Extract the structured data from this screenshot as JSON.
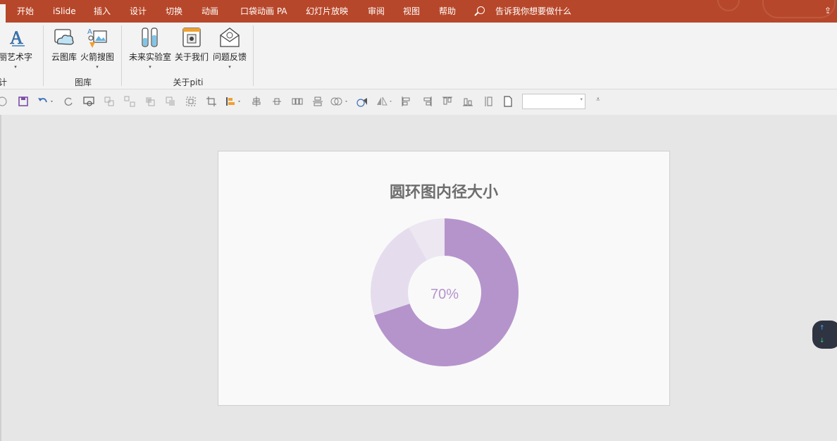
{
  "menu_tabs": [
    "开始",
    "iSlide",
    "插入",
    "设计",
    "切换",
    "动画",
    "口袋动画 PA",
    "幻灯片放映",
    "审阅",
    "视图",
    "帮助"
  ],
  "tell_me": "告诉我你想要做什么",
  "ribbon": {
    "partial_button": "丽艺术字",
    "partial_group": "计",
    "buttons": {
      "cloud_gallery": "云图库",
      "arrow_search": "火箭搜图",
      "future_lab": "未来实验室",
      "about_us": "关于我们",
      "feedback": "问题反馈"
    },
    "groups": {
      "gallery": "图库",
      "about_piti": "关于piti"
    }
  },
  "slide": {
    "title": "圆环图内径大小"
  },
  "chart_data": {
    "type": "pie",
    "title": "圆环图内径大小",
    "center_label": "70%",
    "slices": [
      {
        "value": 70,
        "color": "#b594cc"
      },
      {
        "value": 22,
        "color": "#e5dded"
      },
      {
        "value": 8,
        "color": "#ece7f1"
      }
    ]
  },
  "colors": {
    "accent": "#b7472a",
    "donut_primary": "#b594cc",
    "donut_secondary": "#e5dded",
    "donut_tertiary": "#ece7f1",
    "center_label": "#b594cc"
  }
}
